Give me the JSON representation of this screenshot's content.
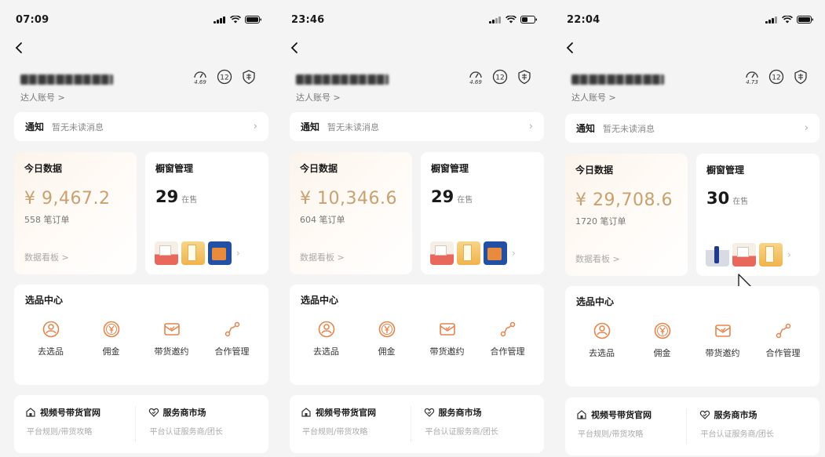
{
  "screens": [
    {
      "time": "07:09",
      "account_link": "达人账号 >",
      "header_badge": "4.69",
      "header_count": "12",
      "notice": {
        "label": "通知",
        "text": "暂无未读消息"
      },
      "today": {
        "title": "今日数据",
        "amount": "¥ 9,467.2",
        "orders": "558 笔订单",
        "link": "数据看板 >"
      },
      "window": {
        "title": "橱窗管理",
        "count": "29",
        "status": "在售"
      }
    },
    {
      "time": "23:46",
      "account_link": "达人账号 >",
      "header_badge": "4.69",
      "header_count": "12",
      "notice": {
        "label": "通知",
        "text": "暂无未读消息"
      },
      "today": {
        "title": "今日数据",
        "amount": "¥ 10,346.6",
        "orders": "604 笔订单",
        "link": "数据看板 >"
      },
      "window": {
        "title": "橱窗管理",
        "count": "29",
        "status": "在售"
      }
    },
    {
      "time": "22:04",
      "account_link": "达人账号 >",
      "header_badge": "4.73",
      "header_count": "12",
      "notice": {
        "label": "通知",
        "text": "暂无未读消息"
      },
      "today": {
        "title": "今日数据",
        "amount": "¥ 29,708.6",
        "orders": "1720 笔订单",
        "link": "数据看板 >"
      },
      "window": {
        "title": "橱窗管理",
        "count": "30",
        "status": "在售"
      }
    }
  ],
  "pick_center": {
    "title": "选品中心",
    "items": [
      {
        "label": "去选品",
        "icon": "select-product-icon"
      },
      {
        "label": "佣金",
        "icon": "commission-icon"
      },
      {
        "label": "带货邀约",
        "icon": "invitation-icon"
      },
      {
        "label": "合作管理",
        "icon": "cooperation-icon"
      }
    ]
  },
  "bottom_links": [
    {
      "title": "视频号带货官网",
      "sub": "平台规则/带货攻略",
      "icon": "official-site-icon"
    },
    {
      "title": "服务商市场",
      "sub": "平台认证服务商/团长",
      "icon": "service-market-icon"
    }
  ],
  "colors": {
    "accent": "#c9a070",
    "icon_orange": "#e8834a",
    "background": "#f4f4f4"
  }
}
